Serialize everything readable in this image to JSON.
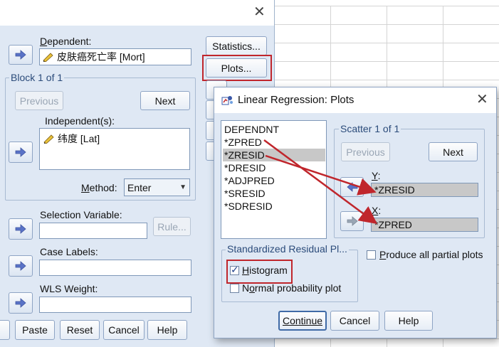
{
  "main_dialog": {
    "dependent_label": "Dependent:",
    "dependent_value": "皮肤癌死亡率 [Mort]",
    "block_label": "Block 1 of 1",
    "previous_label": "Previous",
    "next_label": "Next",
    "independent_label": "Independent(s):",
    "independent_value": "纬度 [Lat]",
    "method_label": "Method:",
    "method_value": "Enter",
    "selection_label": "Selection Variable:",
    "rule_label": "Rule...",
    "case_labels_label": "Case Labels:",
    "wls_label": "WLS Weight:",
    "side_buttons": {
      "statistics": "Statistics...",
      "plots": "Plots..."
    },
    "bottom_buttons": {
      "paste": "Paste",
      "reset": "Reset",
      "cancel": "Cancel",
      "help": "Help"
    }
  },
  "plots_dialog": {
    "title": "Linear Regression: Plots",
    "variables": [
      "DEPENDNT",
      "*ZPRED",
      "*ZRESID",
      "*DRESID",
      "*ADJPRED",
      "*SRESID",
      "*SDRESID"
    ],
    "selected_variable": "*ZRESID",
    "scatter_label": "Scatter 1 of 1",
    "previous_label": "Previous",
    "next_label": "Next",
    "y_label": "Y:",
    "y_value": "*ZRESID",
    "x_label": "X:",
    "x_value": "*ZPRED",
    "std_resid_label": "Standardized Residual Pl...",
    "histogram_label": "Histogram",
    "histogram_checked": true,
    "normal_prob_label": "Normal probability plot",
    "normal_prob_checked": false,
    "partial_plots_label": "Produce all partial plots",
    "partial_plots_checked": false,
    "continue_label": "Continue",
    "cancel_label": "Cancel",
    "help_label": "Help"
  },
  "colors": {
    "annotation_red": "#c0262c",
    "dialog_bg": "#dfe8f4",
    "arrow_blue": "#5a73c7"
  },
  "icons": {
    "variable": "ruler-pencil-icon",
    "move": "arrow-right-icon",
    "dialog": "regression-app-icon"
  }
}
